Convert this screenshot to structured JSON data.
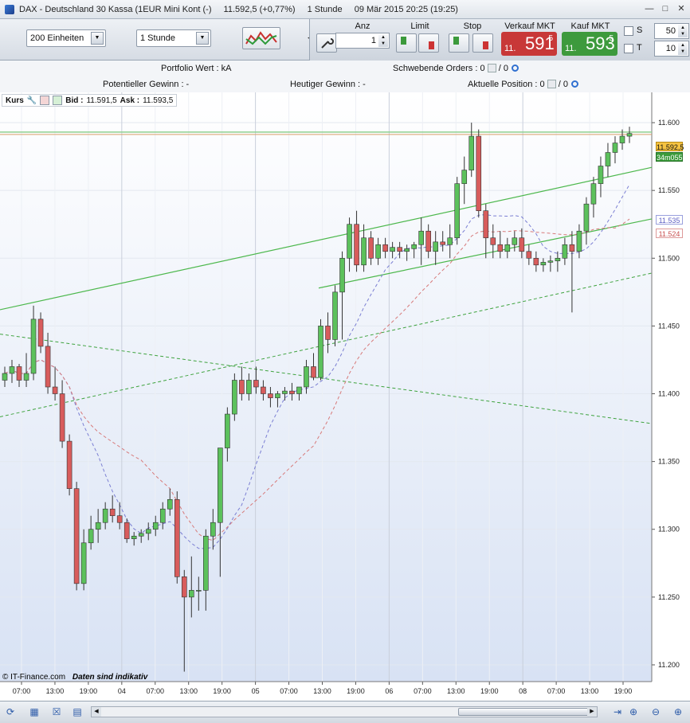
{
  "window": {
    "title_parts": [
      "DAX - Deutschland 30 Kassa (1EUR Mini Kont (-)",
      "11.592,5 (+0,77%)",
      "1 Stunde",
      "09 Mär 2015 20:25 (19:25)"
    ]
  },
  "toolbar": {
    "units_select": "200 Einheiten",
    "interval_select": "1 Stunde",
    "anz_label": "Anz",
    "anz_value": "1",
    "limit_label": "Limit",
    "stop_label": "Stop",
    "sell_label": "Verkauf MKT",
    "buy_label": "Kauf MKT",
    "sell_prefix": "11.",
    "sell_main": "591",
    "sell_sup": "5",
    "buy_prefix": "11.",
    "buy_main": "593",
    "buy_sup": "5",
    "s_label": "S",
    "t_label": "T",
    "s_value": "50",
    "t_value": "10",
    "sell_color": "#c83838",
    "buy_color": "#3d9a3d"
  },
  "info": {
    "portfolio": "Portfolio Wert : kA",
    "pending_orders": "Schwebende Orders : 0",
    "pending_sep": "/ 0",
    "potential_gain": "Potentieller Gewinn : -",
    "today_gain": "Heutiger Gewinn : -",
    "current_position": "Aktuelle Position : 0",
    "position_sep": "/ 0"
  },
  "chart_header": {
    "kurs": "Kurs",
    "bid_label": "Bid :",
    "bid_value": "11.591,5",
    "ask_label": "Ask :",
    "ask_value": "11.593,5"
  },
  "watermark": {
    "brand": "© IT-Finance.com",
    "note": "Daten sind indikativ"
  },
  "price_tags": {
    "last": "11.592,5",
    "timer": "34m055",
    "ma1": "11.535",
    "ma2": "11.524"
  },
  "chart_data": {
    "type": "candlestick",
    "y_ticks": [
      "11.600",
      "11.550",
      "11.500",
      "11.450",
      "11.400",
      "11.350",
      "11.300",
      "11.250",
      "11.200"
    ],
    "ylim": [
      11190,
      11620
    ],
    "x_ticks": [
      "07:00",
      "13:00",
      "19:00",
      "04",
      "07:00",
      "13:00",
      "19:00",
      "05",
      "07:00",
      "13:00",
      "19:00",
      "06",
      "07:00",
      "13:00",
      "19:00",
      "08",
      "07:00",
      "13:00",
      "19:00"
    ],
    "last_price": 11592.5,
    "candles": [
      [
        11410,
        11420,
        11405,
        11415
      ],
      [
        11415,
        11425,
        11408,
        11420
      ],
      [
        11420,
        11422,
        11405,
        11410
      ],
      [
        11410,
        11430,
        11405,
        11415
      ],
      [
        11415,
        11465,
        11410,
        11455
      ],
      [
        11455,
        11460,
        11430,
        11435
      ],
      [
        11435,
        11445,
        11400,
        11405
      ],
      [
        11405,
        11420,
        11395,
        11400
      ],
      [
        11400,
        11410,
        11360,
        11365
      ],
      [
        11365,
        11370,
        11325,
        11330
      ],
      [
        11330,
        11335,
        11255,
        11260
      ],
      [
        11260,
        11300,
        11255,
        11290
      ],
      [
        11290,
        11310,
        11285,
        11300
      ],
      [
        11300,
        11315,
        11290,
        11305
      ],
      [
        11305,
        11320,
        11300,
        11315
      ],
      [
        11315,
        11325,
        11305,
        11310
      ],
      [
        11310,
        11320,
        11300,
        11305
      ],
      [
        11305,
        11308,
        11290,
        11293
      ],
      [
        11293,
        11298,
        11288,
        11295
      ],
      [
        11295,
        11300,
        11290,
        11297
      ],
      [
        11297,
        11305,
        11292,
        11300
      ],
      [
        11300,
        11310,
        11295,
        11305
      ],
      [
        11305,
        11320,
        11300,
        11315
      ],
      [
        11315,
        11330,
        11310,
        11322
      ],
      [
        11322,
        11328,
        11260,
        11265
      ],
      [
        11265,
        11270,
        11195,
        11250
      ],
      [
        11250,
        11280,
        11235,
        11255
      ],
      [
        11255,
        11265,
        11240,
        11255
      ],
      [
        11255,
        11300,
        11240,
        11295
      ],
      [
        11295,
        11315,
        11285,
        11305
      ],
      [
        11305,
        11350,
        11265,
        11360
      ],
      [
        11360,
        11390,
        11350,
        11385
      ],
      [
        11385,
        11415,
        11380,
        11410
      ],
      [
        11410,
        11420,
        11395,
        11400
      ],
      [
        11400,
        11415,
        11395,
        11410
      ],
      [
        11410,
        11420,
        11400,
        11405
      ],
      [
        11405,
        11410,
        11395,
        11400
      ],
      [
        11400,
        11405,
        11390,
        11397
      ],
      [
        11397,
        11402,
        11390,
        11400
      ],
      [
        11400,
        11405,
        11395,
        11402
      ],
      [
        11402,
        11408,
        11395,
        11400
      ],
      [
        11400,
        11405,
        11395,
        11405
      ],
      [
        11405,
        11425,
        11400,
        11420
      ],
      [
        11420,
        11430,
        11410,
        11412
      ],
      [
        11412,
        11455,
        11410,
        11450
      ],
      [
        11450,
        11460,
        11430,
        11440
      ],
      [
        11440,
        11480,
        11435,
        11475
      ],
      [
        11475,
        11505,
        11440,
        11500
      ],
      [
        11500,
        11530,
        11490,
        11525
      ],
      [
        11525,
        11535,
        11490,
        11495
      ],
      [
        11495,
        11525,
        11490,
        11515
      ],
      [
        11515,
        11520,
        11495,
        11500
      ],
      [
        11500,
        11515,
        11495,
        11510
      ],
      [
        11510,
        11515,
        11500,
        11505
      ],
      [
        11505,
        11512,
        11500,
        11508
      ],
      [
        11508,
        11512,
        11500,
        11505
      ],
      [
        11505,
        11510,
        11498,
        11507
      ],
      [
        11507,
        11512,
        11500,
        11510
      ],
      [
        11510,
        11530,
        11495,
        11520
      ],
      [
        11520,
        11525,
        11500,
        11505
      ],
      [
        11505,
        11520,
        11495,
        11512
      ],
      [
        11512,
        11520,
        11505,
        11510
      ],
      [
        11510,
        11525,
        11500,
        11515
      ],
      [
        11515,
        11560,
        11510,
        11555
      ],
      [
        11555,
        11575,
        11540,
        11565
      ],
      [
        11565,
        11600,
        11560,
        11590
      ],
      [
        11590,
        11595,
        11530,
        11535
      ],
      [
        11535,
        11540,
        11500,
        11515
      ],
      [
        11515,
        11525,
        11500,
        11510
      ],
      [
        11510,
        11520,
        11500,
        11505
      ],
      [
        11505,
        11515,
        11500,
        11510
      ],
      [
        11510,
        11520,
        11505,
        11515
      ],
      [
        11515,
        11522,
        11500,
        11505
      ],
      [
        11505,
        11510,
        11495,
        11500
      ],
      [
        11500,
        11505,
        11490,
        11495
      ],
      [
        11495,
        11500,
        11490,
        11497
      ],
      [
        11497,
        11502,
        11490,
        11498
      ],
      [
        11498,
        11505,
        11490,
        11500
      ],
      [
        11500,
        11515,
        11495,
        11510
      ],
      [
        11510,
        11520,
        11460,
        11505
      ],
      [
        11505,
        11525,
        11500,
        11520
      ],
      [
        11520,
        11545,
        11510,
        11540
      ],
      [
        11540,
        11560,
        11530,
        11555
      ],
      [
        11555,
        11575,
        11545,
        11568
      ],
      [
        11568,
        11585,
        11560,
        11578
      ],
      [
        11578,
        11590,
        11570,
        11585
      ],
      [
        11585,
        11595,
        11580,
        11590
      ],
      [
        11590,
        11597,
        11585,
        11592
      ]
    ]
  }
}
